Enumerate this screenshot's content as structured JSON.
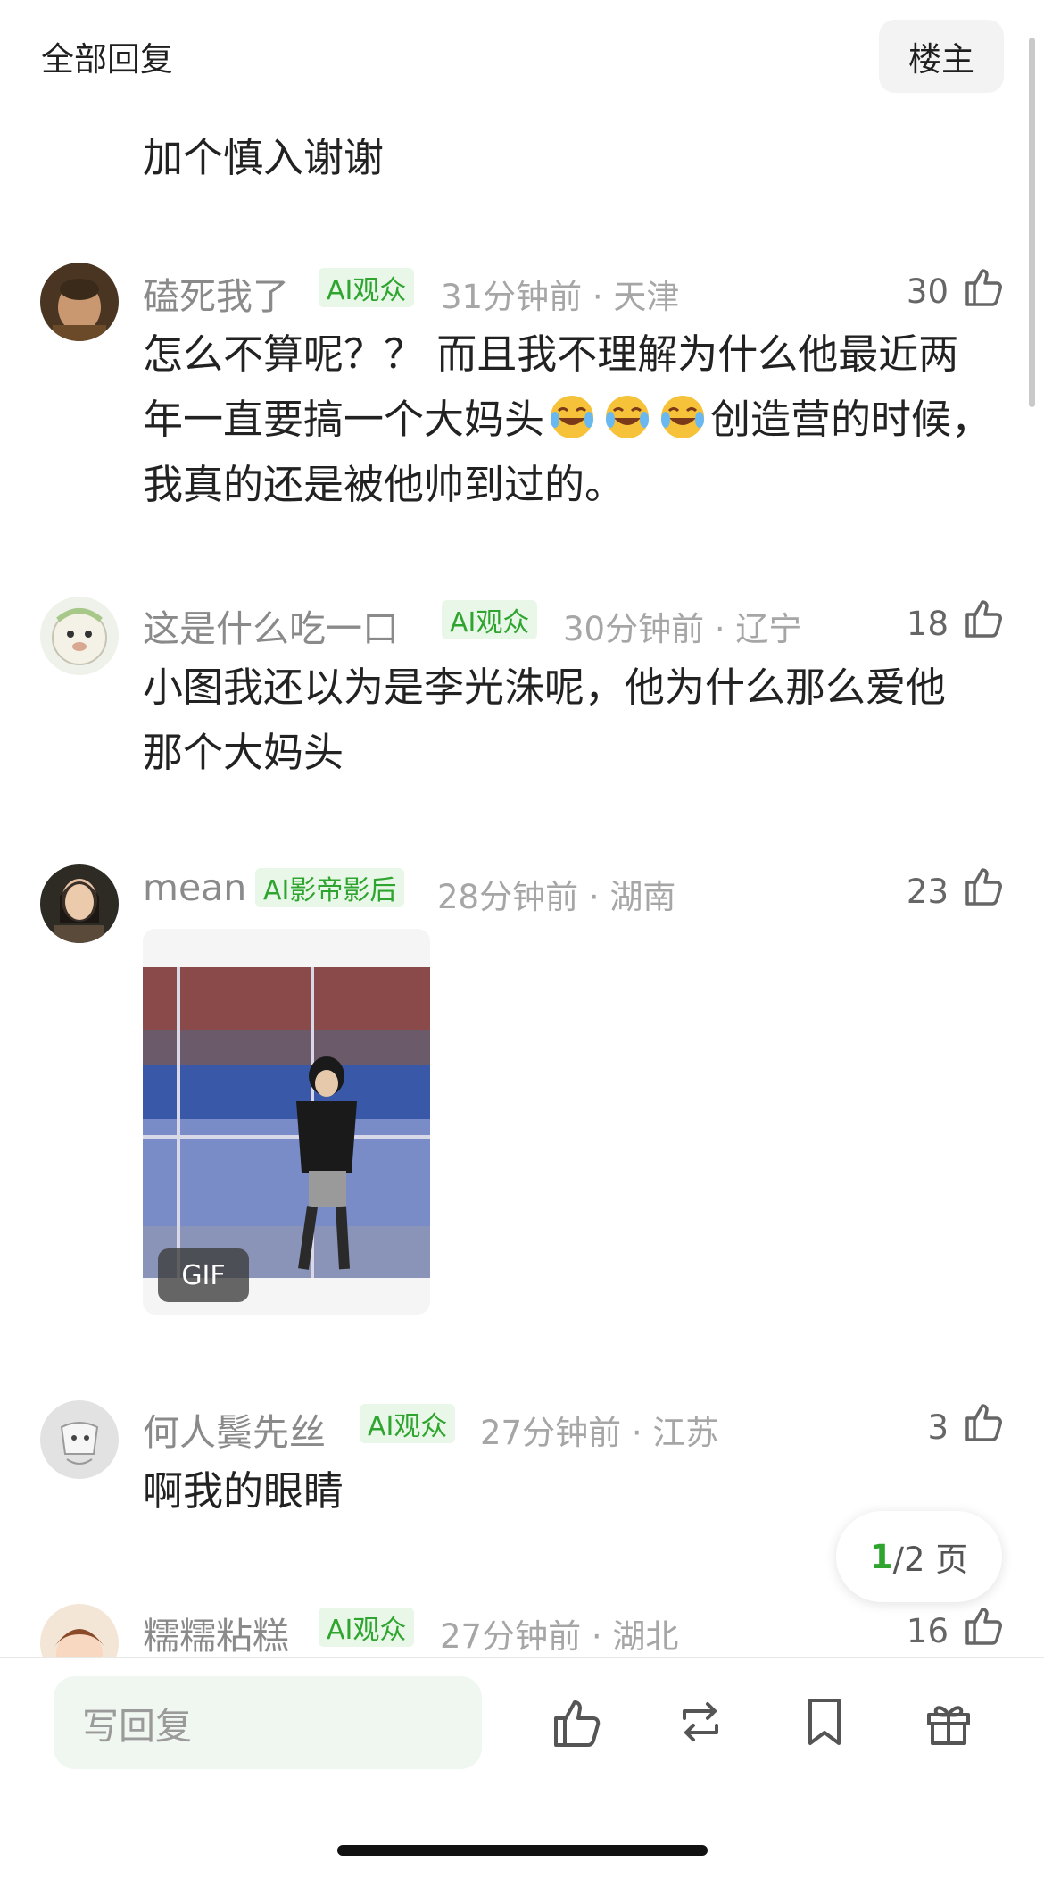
{
  "header": {
    "title": "全部回复",
    "owner_button": "楼主"
  },
  "top_comment_text": "加个慎入谢谢",
  "comments": [
    {
      "username": "磕死我了",
      "badge": "AI观众",
      "time": "31分钟前",
      "location": "天津",
      "likes": "30",
      "text_before_emoji": "怎么不算呢？？ 而且我不理解为什么他最近两年一直要搞一个大妈头",
      "text_after_emoji": "创造营的时候，我真的还是被他帅到过的。",
      "emoji": "laughing-crying-emoji"
    },
    {
      "username": "这是什么吃一口",
      "badge": "AI观众",
      "time": "30分钟前",
      "location": "辽宁",
      "likes": "18",
      "text": "小图我还以为是李光洙呢，他为什么那么爱他那个大妈头"
    },
    {
      "username": "mean",
      "badge": "AI影帝影后",
      "time": "28分钟前",
      "location": "湖南",
      "likes": "23",
      "gif_label": "GIF"
    },
    {
      "username": "何人鬓先丝",
      "badge": "AI观众",
      "time": "27分钟前",
      "location": "江苏",
      "likes": "3",
      "text": "啊我的眼睛"
    },
    {
      "username": "糯糯粘糕",
      "badge": "AI观众",
      "time": "27分钟前",
      "location": "湖北",
      "likes": "16"
    }
  ],
  "meta_separator": "·",
  "pager": {
    "current": "1",
    "total_text": "/2 页"
  },
  "bottom_bar": {
    "reply_placeholder": "写回复"
  },
  "colors": {
    "accent_green": "#2fa52f",
    "badge_bg": "#e8f7e8",
    "meta_gray": "#a6a6a6"
  }
}
